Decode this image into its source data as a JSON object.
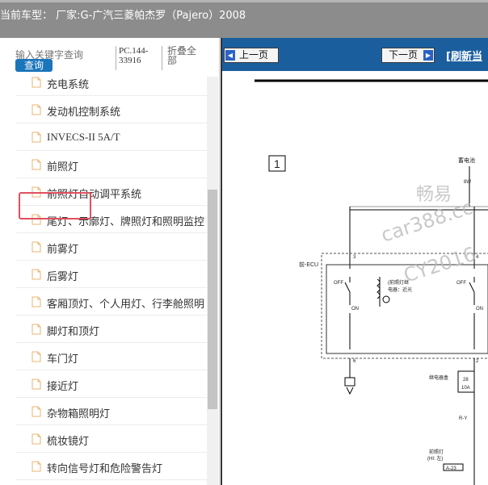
{
  "header": {
    "title": "当前车型：  厂家:G-广汽三菱帕杰罗（Pajero）2008"
  },
  "search": {
    "placeholder": "输入关键字查询",
    "query_label": "查询"
  },
  "pc_code": "PC.144-33916",
  "collapse_all": "折叠全部",
  "tree": {
    "items": [
      {
        "label": "充电系统"
      },
      {
        "label": "发动机控制系统"
      },
      {
        "label": "INVECS-II 5A/T"
      },
      {
        "label": "前照灯",
        "selected": true
      },
      {
        "label": "前照灯自动调平系统"
      },
      {
        "label": "尾灯、示廓灯、牌照灯和照明监控"
      },
      {
        "label": "前雾灯"
      },
      {
        "label": "后雾灯"
      },
      {
        "label": "客厢顶灯、个人用灯、行李舱照明"
      },
      {
        "label": "脚灯和顶灯"
      },
      {
        "label": "车门灯"
      },
      {
        "label": "接近灯"
      },
      {
        "label": "杂物箱照明灯"
      },
      {
        "label": "梳妆镜灯"
      },
      {
        "label": "转向信号灯和危险警告灯"
      }
    ]
  },
  "toolbar": {
    "prev_label": "上一页",
    "next_label": "下一页",
    "refresh_label": "[刷新当"
  },
  "diagram": {
    "section": "1",
    "battery": "蓄电池",
    "wire_top": "8W",
    "ecu": "前-ECU",
    "pin3": "3",
    "pin4": "4",
    "pin6": "6",
    "pin2": "2",
    "off1": "OFF",
    "off2": "OFF",
    "on1": "ON",
    "on2": "ON",
    "relay_label": "(前照灯继\n电器：近光",
    "relay_box": "继电器盒",
    "fuse_num": "28",
    "fuse_amp": "10A",
    "wire_ry": "R-Y",
    "lamp_label": "前照灯\n(HI: 左)",
    "connector": "A-23",
    "wire_b": "B"
  },
  "watermark": {
    "line1": "畅易",
    "line2": "car388.cc",
    "line3": "CY2016"
  },
  "colors": {
    "header_bg": "#8c8c8c",
    "toolbar_bg": "#1b5e9e",
    "accent": "#1b75bb",
    "highlight": "#e05060"
  }
}
